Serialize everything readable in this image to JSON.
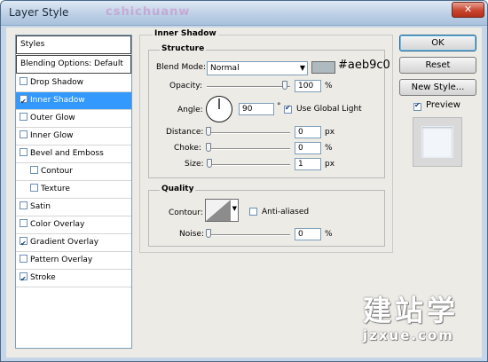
{
  "window": {
    "title": "Layer Style",
    "ghost_title": "cshichuanw",
    "close_glyph": "✕"
  },
  "styles_list": {
    "header": "Styles",
    "blending": "Blending Options: Default",
    "items": [
      {
        "label": "Drop Shadow",
        "checked": false,
        "selected": false,
        "indent": false
      },
      {
        "label": "Inner Shadow",
        "checked": true,
        "selected": true,
        "indent": false
      },
      {
        "label": "Outer Glow",
        "checked": false,
        "selected": false,
        "indent": false
      },
      {
        "label": "Inner Glow",
        "checked": false,
        "selected": false,
        "indent": false
      },
      {
        "label": "Bevel and Emboss",
        "checked": false,
        "selected": false,
        "indent": false
      },
      {
        "label": "Contour",
        "checked": false,
        "selected": false,
        "indent": true
      },
      {
        "label": "Texture",
        "checked": false,
        "selected": false,
        "indent": true
      },
      {
        "label": "Satin",
        "checked": false,
        "selected": false,
        "indent": false
      },
      {
        "label": "Color Overlay",
        "checked": false,
        "selected": false,
        "indent": false
      },
      {
        "label": "Gradient Overlay",
        "checked": true,
        "selected": false,
        "indent": false
      },
      {
        "label": "Pattern Overlay",
        "checked": false,
        "selected": false,
        "indent": false
      },
      {
        "label": "Stroke",
        "checked": true,
        "selected": false,
        "indent": false
      }
    ]
  },
  "panel": {
    "title": "Inner Shadow",
    "structure": {
      "title": "Structure",
      "blend_mode_label": "Blend Mode:",
      "blend_mode_value": "Normal",
      "color_hex": "#aeb9c0",
      "opacity_label": "Opacity:",
      "opacity_value": "100",
      "opacity_unit": "%",
      "angle_label": "Angle:",
      "angle_value": "90",
      "angle_unit": "°",
      "global_light_label": "Use Global Light",
      "global_light_checked": true,
      "distance_label": "Distance:",
      "distance_value": "0",
      "distance_unit": "px",
      "choke_label": "Choke:",
      "choke_value": "0",
      "choke_unit": "%",
      "size_label": "Size:",
      "size_value": "1",
      "size_unit": "px"
    },
    "quality": {
      "title": "Quality",
      "contour_label": "Contour:",
      "anti_aliased_label": "Anti-aliased",
      "anti_aliased_checked": false,
      "noise_label": "Noise:",
      "noise_value": "0",
      "noise_unit": "%"
    }
  },
  "buttons": {
    "ok": "OK",
    "reset": "Reset",
    "new_style": "New Style...",
    "preview": "Preview",
    "preview_checked": true
  },
  "watermark": {
    "chars": "建站学",
    "site": "jzxue.com"
  },
  "colors": {
    "selection": "#3399ff",
    "shadow_color": "#aeb9c0"
  }
}
